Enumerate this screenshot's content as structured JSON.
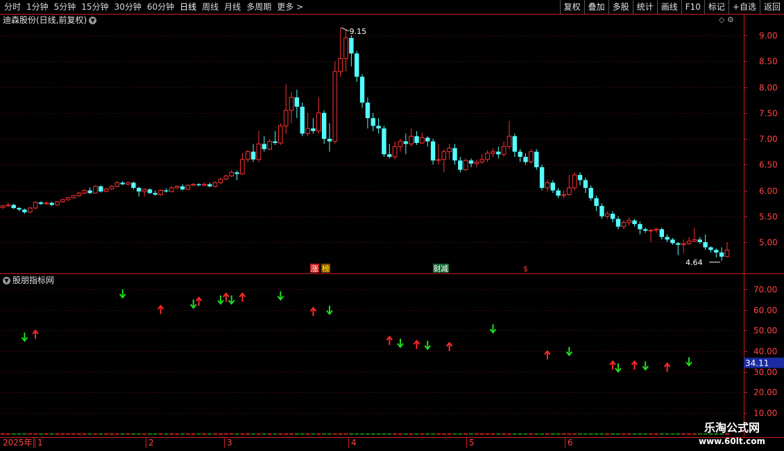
{
  "toolbar": {
    "left_items": [
      "分时",
      "1分钟",
      "5分钟",
      "15分钟",
      "30分钟",
      "60分钟",
      "日线",
      "周线",
      "月线",
      "多周期",
      "更多 >"
    ],
    "right_items": [
      "复权",
      "叠加",
      "多股",
      "统计",
      "画线",
      "F10",
      "标记",
      "+自选",
      "返回"
    ]
  },
  "main_chart": {
    "title": "迪森股份(日线,前复权)",
    "y_ticks": [
      "9.00",
      "8.50",
      "8.00",
      "7.50",
      "7.00",
      "6.50",
      "6.00",
      "5.50",
      "5.00"
    ],
    "high_label": "9.15",
    "low_label": "4.64",
    "event_labels": [
      "涨",
      "榜",
      "财",
      "减",
      "$"
    ],
    "up_color": "#ff3333",
    "down_color": "#54ffff",
    "candles": [
      [
        5.67,
        5.7,
        5.72,
        5.65
      ],
      [
        5.7,
        5.72,
        5.76,
        5.68
      ],
      [
        5.72,
        5.66,
        5.74,
        5.64
      ],
      [
        5.66,
        5.63,
        5.68,
        5.6
      ],
      [
        5.63,
        5.58,
        5.65,
        5.55
      ],
      [
        5.58,
        5.66,
        5.68,
        5.57
      ],
      [
        5.66,
        5.77,
        5.79,
        5.64
      ],
      [
        5.77,
        5.74,
        5.79,
        5.72
      ],
      [
        5.74,
        5.76,
        5.78,
        5.72
      ],
      [
        5.76,
        5.72,
        5.78,
        5.7
      ],
      [
        5.72,
        5.78,
        5.8,
        5.71
      ],
      [
        5.78,
        5.82,
        5.84,
        5.76
      ],
      [
        5.82,
        5.86,
        5.88,
        5.8
      ],
      [
        5.86,
        5.9,
        5.92,
        5.84
      ],
      [
        5.9,
        5.95,
        5.97,
        5.88
      ],
      [
        5.95,
        6.0,
        6.02,
        5.93
      ],
      [
        6.0,
        5.95,
        6.06,
        5.93
      ],
      [
        5.95,
        6.08,
        6.1,
        5.94
      ],
      [
        6.08,
        5.98,
        6.1,
        5.96
      ],
      [
        5.98,
        6.03,
        6.05,
        5.97
      ],
      [
        6.03,
        6.08,
        6.1,
        6.01
      ],
      [
        6.08,
        6.15,
        6.18,
        6.06
      ],
      [
        6.15,
        6.12,
        6.18,
        6.1
      ],
      [
        6.12,
        6.15,
        6.17,
        6.1
      ],
      [
        6.15,
        6.05,
        6.17,
        6.02
      ],
      [
        6.05,
        5.98,
        6.07,
        5.88
      ],
      [
        5.98,
        6.02,
        6.04,
        5.88
      ],
      [
        6.02,
        5.95,
        6.04,
        5.93
      ],
      [
        5.95,
        5.92,
        6.0,
        5.9
      ],
      [
        5.92,
        6.0,
        6.02,
        5.9
      ],
      [
        6.0,
        5.98,
        6.04,
        5.96
      ],
      [
        5.98,
        6.05,
        6.08,
        5.96
      ],
      [
        6.05,
        6.08,
        6.1,
        6.03
      ],
      [
        6.08,
        6.02,
        6.12,
        6.0
      ],
      [
        6.02,
        6.1,
        6.12,
        6.01
      ],
      [
        6.1,
        6.12,
        6.14,
        6.08
      ],
      [
        6.12,
        6.1,
        6.14,
        6.08
      ],
      [
        6.1,
        6.12,
        6.15,
        6.08
      ],
      [
        6.12,
        6.08,
        6.15,
        6.06
      ],
      [
        6.08,
        6.15,
        6.18,
        6.06
      ],
      [
        6.15,
        6.22,
        6.25,
        6.12
      ],
      [
        6.22,
        6.28,
        6.3,
        6.2
      ],
      [
        6.28,
        6.35,
        6.4,
        6.26
      ],
      [
        6.35,
        6.32,
        6.38,
        6.2
      ],
      [
        6.32,
        6.6,
        6.72,
        6.3
      ],
      [
        6.6,
        6.75,
        6.78,
        6.55
      ],
      [
        6.75,
        6.6,
        6.9,
        6.55
      ],
      [
        6.6,
        6.9,
        7.15,
        6.55
      ],
      [
        6.9,
        6.8,
        7.05,
        6.75
      ],
      [
        6.8,
        6.95,
        7.0,
        6.78
      ],
      [
        6.95,
        6.92,
        7.15,
        6.88
      ],
      [
        6.92,
        7.25,
        7.3,
        6.88
      ],
      [
        7.25,
        7.55,
        8.05,
        7.1
      ],
      [
        7.55,
        7.8,
        7.9,
        7.3
      ],
      [
        7.8,
        7.62,
        7.95,
        7.4
      ],
      [
        7.62,
        7.1,
        7.7,
        7.05
      ],
      [
        7.1,
        7.2,
        7.5,
        7.05
      ],
      [
        7.2,
        7.15,
        7.4,
        7.1
      ],
      [
        7.15,
        7.5,
        7.8,
        7.1
      ],
      [
        7.5,
        7.0,
        7.55,
        6.9
      ],
      [
        7.0,
        6.95,
        7.3,
        6.75
      ],
      [
        6.95,
        8.3,
        8.5,
        6.9
      ],
      [
        8.3,
        8.55,
        9.15,
        8.2
      ],
      [
        8.55,
        8.95,
        9.1,
        8.3
      ],
      [
        8.95,
        8.65,
        9.0,
        8.4
      ],
      [
        8.65,
        8.2,
        8.7,
        8.1
      ],
      [
        8.2,
        7.7,
        8.25,
        7.6
      ],
      [
        7.7,
        7.4,
        7.8,
        7.2
      ],
      [
        7.4,
        7.25,
        7.5,
        7.15
      ],
      [
        7.25,
        7.2,
        7.4,
        7.1
      ],
      [
        7.2,
        6.7,
        7.25,
        6.65
      ],
      [
        6.7,
        6.65,
        6.9,
        6.62
      ],
      [
        6.65,
        6.85,
        6.95,
        6.6
      ],
      [
        6.85,
        6.95,
        7.0,
        6.75
      ],
      [
        6.95,
        6.9,
        7.1,
        6.7
      ],
      [
        6.9,
        7.05,
        7.2,
        6.85
      ],
      [
        7.05,
        6.92,
        7.15,
        6.88
      ],
      [
        6.92,
        7.02,
        7.12,
        6.9
      ],
      [
        7.02,
        6.95,
        7.05,
        6.85
      ],
      [
        6.95,
        6.58,
        7.0,
        6.5
      ],
      [
        6.58,
        6.6,
        6.9,
        6.5
      ],
      [
        6.6,
        6.75,
        6.8,
        6.35
      ],
      [
        6.75,
        6.82,
        6.9,
        6.6
      ],
      [
        6.82,
        6.58,
        6.9,
        6.5
      ],
      [
        6.58,
        6.4,
        6.65,
        6.35
      ],
      [
        6.4,
        6.58,
        6.62,
        6.38
      ],
      [
        6.58,
        6.52,
        6.62,
        6.45
      ],
      [
        6.52,
        6.55,
        6.6,
        6.45
      ],
      [
        6.55,
        6.6,
        6.7,
        6.52
      ],
      [
        6.6,
        6.72,
        6.78,
        6.55
      ],
      [
        6.72,
        6.75,
        6.82,
        6.65
      ],
      [
        6.75,
        6.7,
        6.85,
        6.62
      ],
      [
        6.7,
        6.85,
        6.95,
        6.65
      ],
      [
        6.85,
        7.05,
        7.35,
        6.8
      ],
      [
        7.05,
        6.75,
        7.1,
        6.65
      ],
      [
        6.75,
        6.65,
        6.8,
        6.55
      ],
      [
        6.65,
        6.55,
        6.72,
        6.5
      ],
      [
        6.55,
        6.75,
        6.8,
        6.52
      ],
      [
        6.75,
        6.45,
        6.8,
        6.4
      ],
      [
        6.45,
        6.05,
        6.5,
        6.0
      ],
      [
        6.05,
        6.15,
        6.2,
        5.98
      ],
      [
        6.15,
        6.0,
        6.2,
        5.95
      ],
      [
        6.0,
        5.9,
        6.05,
        5.85
      ],
      [
        5.9,
        5.92,
        6.0,
        5.85
      ],
      [
        5.92,
        6.05,
        6.3,
        5.9
      ],
      [
        6.05,
        6.3,
        6.35,
        6.0
      ],
      [
        6.3,
        6.2,
        6.35,
        6.1
      ],
      [
        6.2,
        6.05,
        6.25,
        5.95
      ],
      [
        6.05,
        5.85,
        6.1,
        5.8
      ],
      [
        5.85,
        5.7,
        5.9,
        5.6
      ],
      [
        5.7,
        5.5,
        5.75,
        5.45
      ],
      [
        5.5,
        5.55,
        5.6,
        5.45
      ],
      [
        5.55,
        5.45,
        5.6,
        5.38
      ],
      [
        5.45,
        5.3,
        5.5,
        5.25
      ],
      [
        5.3,
        5.38,
        5.42,
        5.25
      ],
      [
        5.38,
        5.42,
        5.48,
        5.32
      ],
      [
        5.42,
        5.35,
        5.45,
        5.3
      ],
      [
        5.35,
        5.25,
        5.4,
        5.15
      ],
      [
        5.25,
        5.22,
        5.28,
        5.18
      ],
      [
        5.22,
        5.23,
        5.25,
        5.0
      ],
      [
        5.23,
        5.25,
        5.28,
        5.18
      ],
      [
        5.25,
        5.1,
        5.28,
        5.05
      ],
      [
        5.1,
        5.05,
        5.15,
        5.0
      ],
      [
        5.05,
        4.98,
        5.08,
        4.95
      ],
      [
        4.98,
        4.95,
        5.0,
        4.75
      ],
      [
        4.95,
        4.97,
        5.05,
        4.78
      ],
      [
        4.97,
        5.02,
        5.1,
        4.95
      ],
      [
        5.02,
        5.05,
        5.28,
        5.0
      ],
      [
        5.05,
        5.0,
        5.1,
        4.97
      ],
      [
        5.0,
        4.9,
        5.15,
        4.85
      ],
      [
        4.9,
        4.85,
        4.92,
        4.8
      ],
      [
        4.85,
        4.8,
        4.88,
        4.7
      ],
      [
        4.8,
        4.72,
        4.9,
        4.64
      ],
      [
        4.72,
        4.85,
        5.0,
        4.7
      ]
    ]
  },
  "indicator": {
    "title": "股朋指标网",
    "y_ticks": [
      "70.00",
      "60.00",
      "50.00",
      "40.00",
      "30.00",
      "20.00",
      "10.00"
    ],
    "current_value": "34.11",
    "arrows": [
      [
        4,
        "down",
        47
      ],
      [
        6,
        "up",
        48
      ],
      [
        22,
        "down",
        68
      ],
      [
        29,
        "up",
        60
      ],
      [
        35,
        "down",
        63
      ],
      [
        36,
        "up",
        64
      ],
      [
        40,
        "down",
        65
      ],
      [
        41,
        "up",
        66
      ],
      [
        42,
        "down",
        65
      ],
      [
        44,
        "up",
        66
      ],
      [
        51,
        "down",
        67
      ],
      [
        57,
        "up",
        59
      ],
      [
        60,
        "down",
        60
      ],
      [
        71,
        "up",
        45
      ],
      [
        73,
        "down",
        44
      ],
      [
        76,
        "up",
        43
      ],
      [
        78,
        "down",
        43
      ],
      [
        82,
        "up",
        42
      ],
      [
        90,
        "down",
        51
      ],
      [
        100,
        "up",
        38
      ],
      [
        104,
        "down",
        40
      ],
      [
        112,
        "up",
        33
      ],
      [
        113,
        "down",
        32
      ],
      [
        116,
        "up",
        33
      ],
      [
        118,
        "down",
        33
      ],
      [
        122,
        "up",
        32
      ],
      [
        126,
        "down",
        35
      ]
    ]
  },
  "timeline": {
    "year_label": "2025年",
    "month_labels": [
      "1",
      "2",
      "3",
      "4",
      "5",
      "6"
    ]
  },
  "watermark": {
    "title": "乐淘公式网",
    "url": "www.60lt.com"
  }
}
